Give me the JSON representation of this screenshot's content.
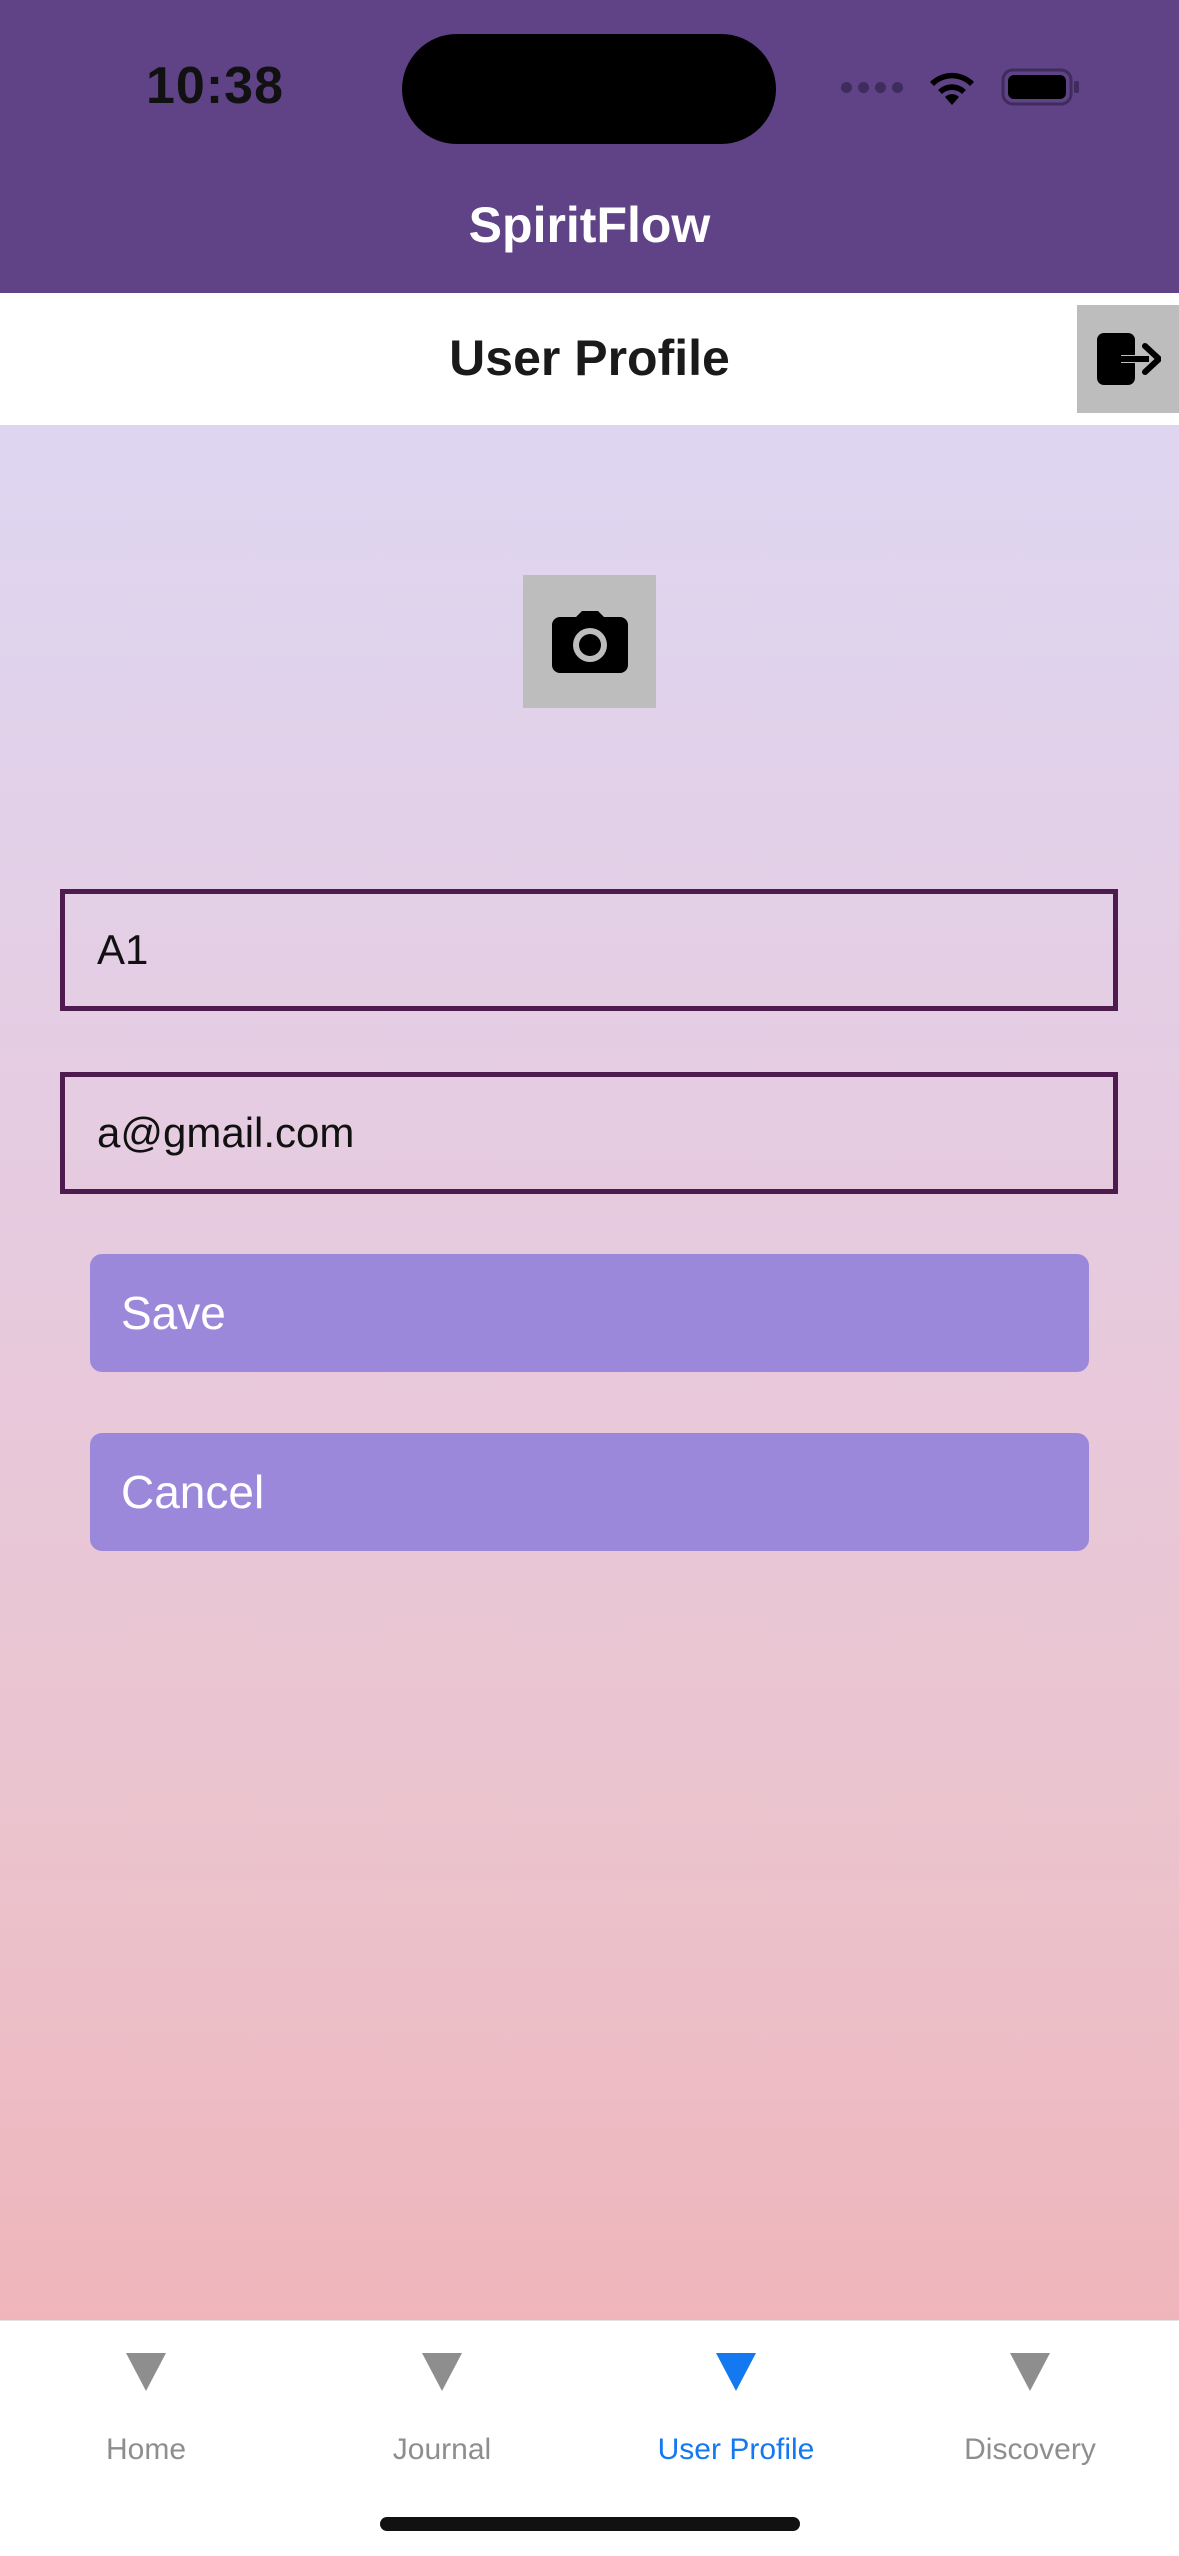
{
  "status_bar": {
    "time": "10:38"
  },
  "app": {
    "title": "SpiritFlow"
  },
  "navbar": {
    "title": "User Profile",
    "logout_icon": "logout-icon"
  },
  "profile": {
    "photo_icon": "camera-icon",
    "name_value": "A1",
    "email_value": "a@gmail.com",
    "save_label": "Save",
    "cancel_label": "Cancel"
  },
  "tabs": [
    {
      "label": "Home",
      "active": false
    },
    {
      "label": "Journal",
      "active": false
    },
    {
      "label": "User Profile",
      "active": true
    },
    {
      "label": "Discovery",
      "active": false
    }
  ],
  "colors": {
    "header": "#5f4386",
    "field_border": "#4e1b4f",
    "button": "#9b88db",
    "active_tab": "#1478f0",
    "inactive_tab": "#8e8e8e"
  }
}
